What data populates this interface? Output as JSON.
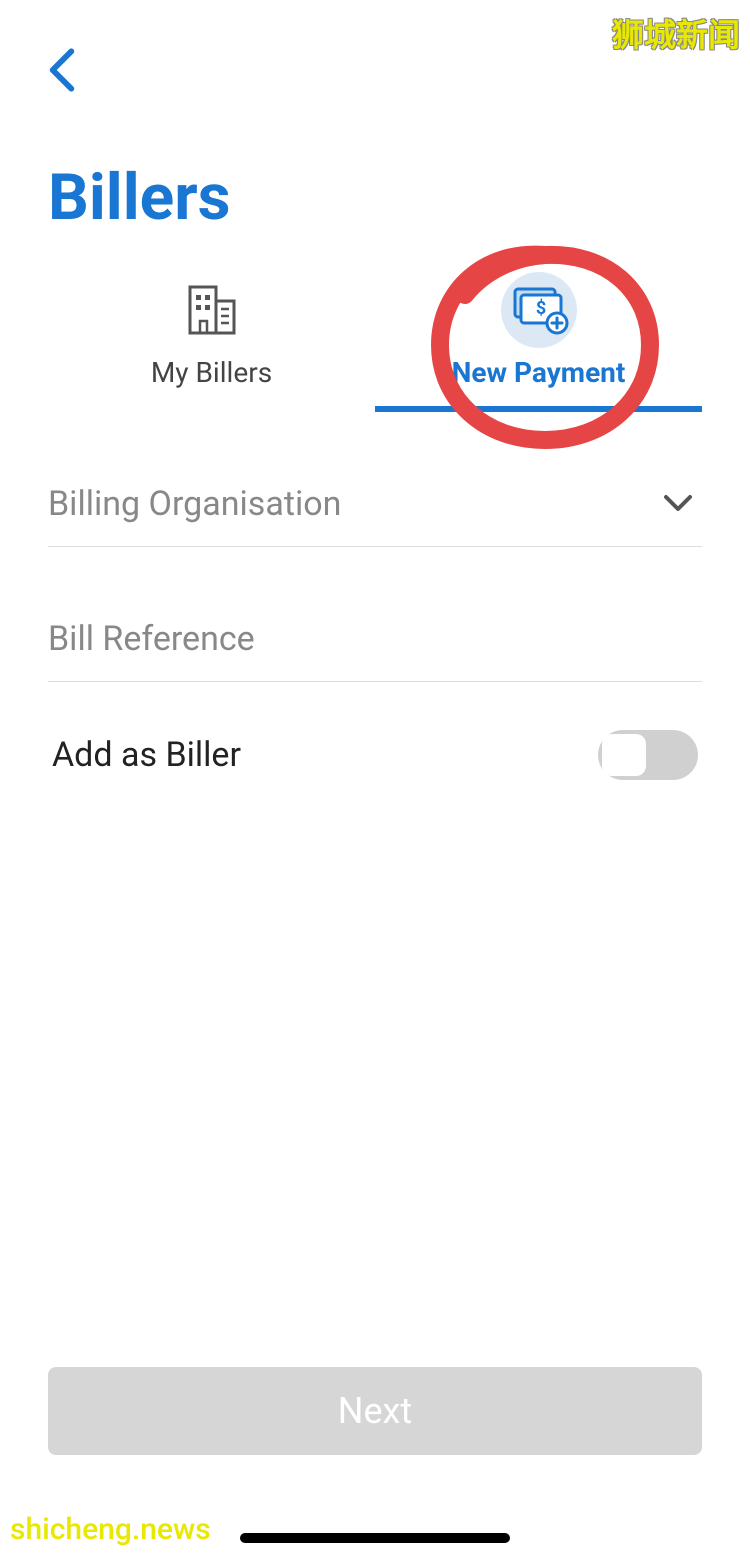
{
  "watermarks": {
    "top": "狮城新闻",
    "bottom": "shicheng.news"
  },
  "header": {
    "title": "Billers"
  },
  "tabs": {
    "my_billers": {
      "label": "My Billers",
      "icon": "buildings-icon",
      "active": false
    },
    "new_payment": {
      "label": "New Payment",
      "icon": "money-plus-icon",
      "active": true
    }
  },
  "form": {
    "billing_org": {
      "label": "Billing Organisation",
      "value": ""
    },
    "bill_reference": {
      "label": "Bill Reference",
      "value": ""
    },
    "add_as_biller": {
      "label": "Add as Biller",
      "enabled": false
    }
  },
  "footer": {
    "next_button": "Next"
  },
  "annotation": {
    "circled_element": "new_payment_tab",
    "color": "#e64545"
  },
  "colors": {
    "primary": "#1976d2",
    "disabled": "#d6d6d6",
    "text_muted": "#888"
  }
}
